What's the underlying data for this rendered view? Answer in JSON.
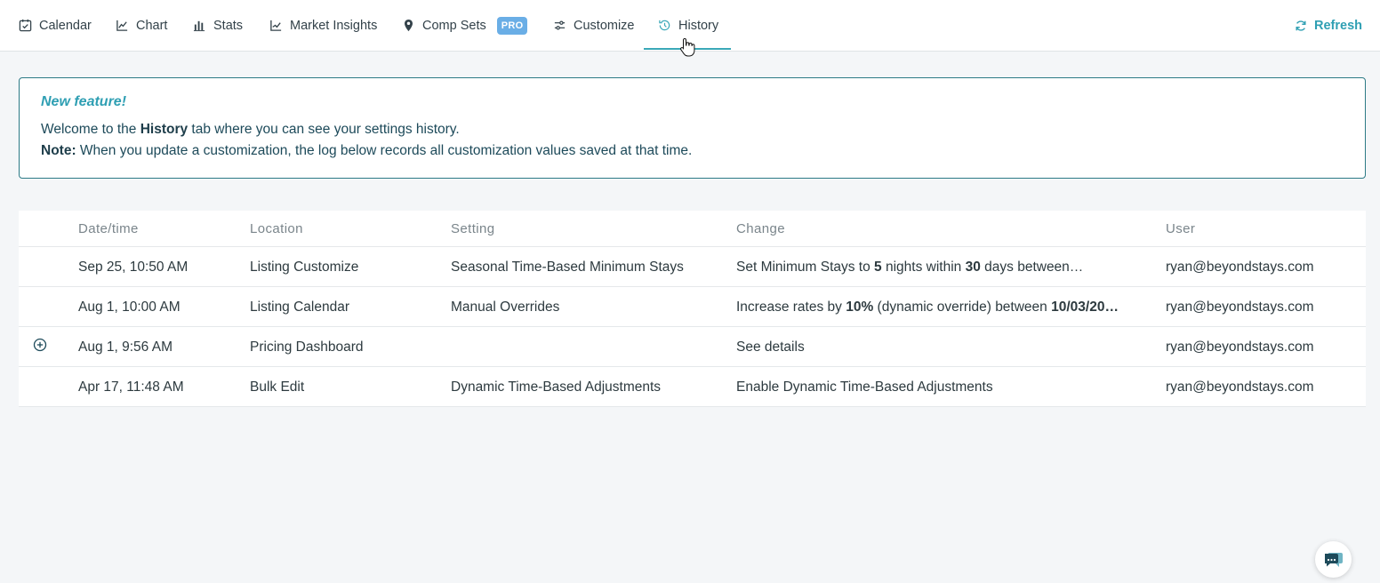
{
  "nav": {
    "tabs": [
      {
        "label": "Calendar",
        "icon": "calendar-icon"
      },
      {
        "label": "Chart",
        "icon": "line-chart-icon"
      },
      {
        "label": "Stats",
        "icon": "bar-chart-icon"
      },
      {
        "label": "Market Insights",
        "icon": "trend-chart-icon"
      },
      {
        "label": "Comp Sets",
        "icon": "map-pin-icon",
        "badge": "PRO"
      },
      {
        "label": "Customize",
        "icon": "sliders-icon"
      },
      {
        "label": "History",
        "icon": "history-icon",
        "active": true
      }
    ],
    "refresh_label": "Refresh"
  },
  "notice": {
    "title": "New feature!",
    "line1_pre": "Welcome to the ",
    "line1_bold": "History",
    "line1_post": " tab where you can see your settings history.",
    "line2_bold": "Note:",
    "line2_text": " When you update a customization, the log below records all customization values saved at that time."
  },
  "table": {
    "columns": [
      "Date/time",
      "Location",
      "Setting",
      "Change",
      "User"
    ],
    "rows": [
      {
        "date": "Sep 25, 10:50 AM",
        "location": "Listing Customize",
        "setting": "Seasonal Time-Based Minimum Stays",
        "change_parts": [
          {
            "t": "Set Minimum Stays to "
          },
          {
            "t": "5",
            "b": true
          },
          {
            "t": " nights within "
          },
          {
            "t": "30",
            "b": true
          },
          {
            "t": " days between…"
          }
        ],
        "user": "ryan@beyondstays.com"
      },
      {
        "date": "Aug 1, 10:00 AM",
        "location": "Listing Calendar",
        "setting": "Manual Overrides",
        "change_parts": [
          {
            "t": "Increase rates by "
          },
          {
            "t": "10%",
            "b": true
          },
          {
            "t": " (dynamic override) between "
          },
          {
            "t": "10/03/20…",
            "b": true
          }
        ],
        "user": "ryan@beyondstays.com"
      },
      {
        "date": "Aug 1, 9:56 AM",
        "location": "Pricing Dashboard",
        "setting": "",
        "change_parts": [
          {
            "t": "See details"
          }
        ],
        "user": "ryan@beyondstays.com",
        "expandable": true
      },
      {
        "date": "Apr 17, 11:48 AM",
        "location": "Bulk Edit",
        "setting": "Dynamic Time-Based Adjustments",
        "change_parts": [
          {
            "t": "Enable Dynamic Time-Based Adjustments"
          }
        ],
        "user": "ryan@beyondstays.com"
      }
    ]
  },
  "colors": {
    "accent": "#2f9fb3",
    "badge": "#6aaee6",
    "notice_border": "#2c7a86"
  }
}
